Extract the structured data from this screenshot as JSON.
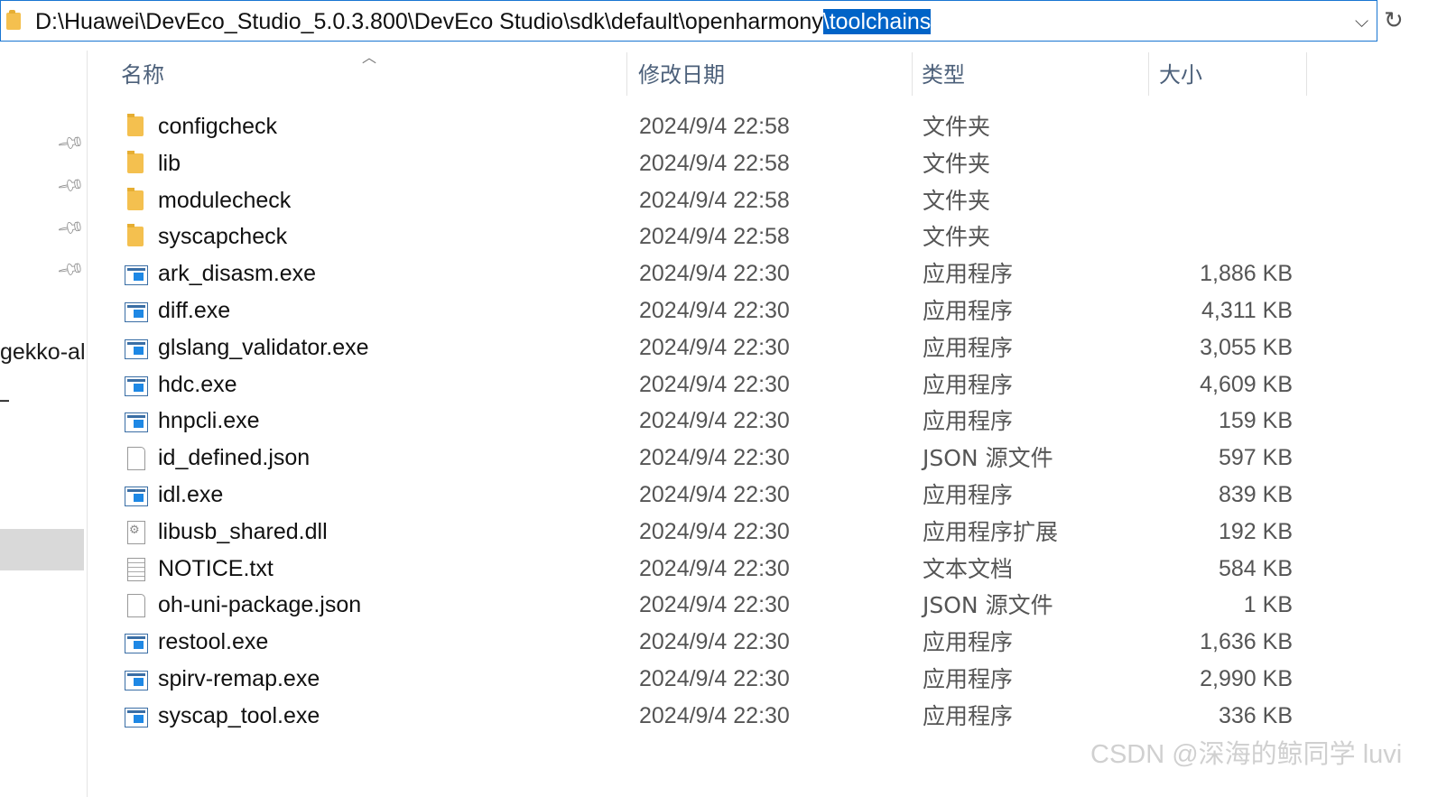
{
  "address": {
    "path_prefix": "D:\\Huawei\\DevEco_Studio_5.0.3.800\\DevEco Studio\\sdk\\default\\openharmony",
    "path_selected": "\\toolchains"
  },
  "nav": {
    "partial_item": "gekko-all-",
    "partial_item2": "_"
  },
  "columns": {
    "name": "名称",
    "date": "修改日期",
    "type": "类型",
    "size": "大小"
  },
  "files": [
    {
      "name": "configcheck",
      "date": "2024/9/4 22:58",
      "type": "文件夹",
      "size": "",
      "icon": "folder-icon"
    },
    {
      "name": "lib",
      "date": "2024/9/4 22:58",
      "type": "文件夹",
      "size": "",
      "icon": "folder-icon"
    },
    {
      "name": "modulecheck",
      "date": "2024/9/4 22:58",
      "type": "文件夹",
      "size": "",
      "icon": "folder-icon"
    },
    {
      "name": "syscapcheck",
      "date": "2024/9/4 22:58",
      "type": "文件夹",
      "size": "",
      "icon": "folder-icon"
    },
    {
      "name": "ark_disasm.exe",
      "date": "2024/9/4 22:30",
      "type": "应用程序",
      "size": "1,886 KB",
      "icon": "exe-icon"
    },
    {
      "name": "diff.exe",
      "date": "2024/9/4 22:30",
      "type": "应用程序",
      "size": "4,311 KB",
      "icon": "exe-icon"
    },
    {
      "name": "glslang_validator.exe",
      "date": "2024/9/4 22:30",
      "type": "应用程序",
      "size": "3,055 KB",
      "icon": "exe-icon"
    },
    {
      "name": "hdc.exe",
      "date": "2024/9/4 22:30",
      "type": "应用程序",
      "size": "4,609 KB",
      "icon": "exe-icon"
    },
    {
      "name": "hnpcli.exe",
      "date": "2024/9/4 22:30",
      "type": "应用程序",
      "size": "159 KB",
      "icon": "exe-icon"
    },
    {
      "name": "id_defined.json",
      "date": "2024/9/4 22:30",
      "type": "JSON 源文件",
      "size": "597 KB",
      "icon": "file-icon"
    },
    {
      "name": "idl.exe",
      "date": "2024/9/4 22:30",
      "type": "应用程序",
      "size": "839 KB",
      "icon": "exe-icon"
    },
    {
      "name": "libusb_shared.dll",
      "date": "2024/9/4 22:30",
      "type": "应用程序扩展",
      "size": "192 KB",
      "icon": "dll-icon"
    },
    {
      "name": "NOTICE.txt",
      "date": "2024/9/4 22:30",
      "type": "文本文档",
      "size": "584 KB",
      "icon": "text-file-icon"
    },
    {
      "name": "oh-uni-package.json",
      "date": "2024/9/4 22:30",
      "type": "JSON 源文件",
      "size": "1 KB",
      "icon": "file-icon"
    },
    {
      "name": "restool.exe",
      "date": "2024/9/4 22:30",
      "type": "应用程序",
      "size": "1,636 KB",
      "icon": "exe-icon"
    },
    {
      "name": "spirv-remap.exe",
      "date": "2024/9/4 22:30",
      "type": "应用程序",
      "size": "2,990 KB",
      "icon": "exe-icon"
    },
    {
      "name": "syscap_tool.exe",
      "date": "2024/9/4 22:30",
      "type": "应用程序",
      "size": "336 KB",
      "icon": "exe-icon"
    }
  ],
  "watermark": "CSDN @深海的鲸同学 luvi"
}
